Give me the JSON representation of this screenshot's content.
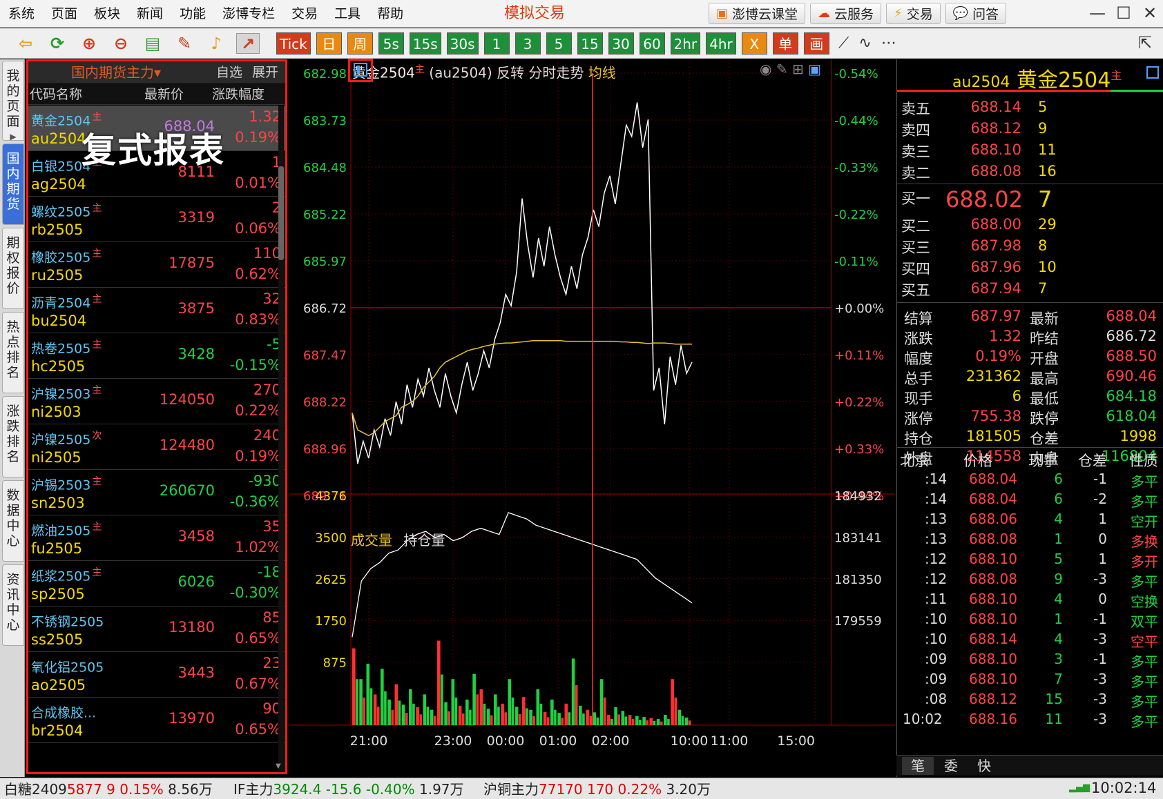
{
  "menu": {
    "items": [
      "系统",
      "页面",
      "板块",
      "新闻",
      "功能",
      "澎博专栏",
      "交易",
      "工具",
      "帮助"
    ],
    "app_title": "模拟交易",
    "buttons": [
      "澎博云课堂",
      "云服务",
      "交易",
      "问答"
    ]
  },
  "periods": [
    "Tick",
    "日",
    "周",
    "5s",
    "15s",
    "30s",
    "1",
    "3",
    "5",
    "15",
    "30",
    "60",
    "2hr",
    "4hr",
    "X",
    "单",
    "画"
  ],
  "sidebar": {
    "tabs": [
      "我的页面",
      "国内期货",
      "期权报价",
      "热点排名",
      "涨跌排名",
      "数据中心",
      "资讯中心"
    ]
  },
  "quote": {
    "title": "国内期货主力",
    "title_arrow": "▾",
    "options": "自选 展开",
    "columns": [
      "代码名称",
      "最新价",
      "涨跌幅度"
    ],
    "watermark": "复式报表",
    "rows": [
      {
        "name": "黄金2504",
        "tag": "主",
        "code": "au2504",
        "price": "688.04",
        "change": "1.32",
        "pct": "0.19%",
        "dir": "up"
      },
      {
        "name": "白银2504",
        "tag": "主",
        "code": "ag2504",
        "price": "8111",
        "change": "1",
        "pct": "0.01%",
        "dir": "up"
      },
      {
        "name": "螺纹2505",
        "tag": "主",
        "code": "rb2505",
        "price": "3319",
        "change": "2",
        "pct": "0.06%",
        "dir": "up"
      },
      {
        "name": "橡胶2505",
        "tag": "主",
        "code": "ru2505",
        "price": "17875",
        "change": "110",
        "pct": "0.62%",
        "dir": "up"
      },
      {
        "name": "沥青2504",
        "tag": "主",
        "code": "bu2504",
        "price": "3875",
        "change": "32",
        "pct": "0.83%",
        "dir": "up"
      },
      {
        "name": "热卷2505",
        "tag": "主",
        "code": "hc2505",
        "price": "3428",
        "change": "-5",
        "pct": "-0.15%",
        "dir": "down"
      },
      {
        "name": "沪镍2503",
        "tag": "主",
        "code": "ni2503",
        "price": "124050",
        "change": "270",
        "pct": "0.22%",
        "dir": "up"
      },
      {
        "name": "沪镍2505",
        "tag": "次",
        "code": "ni2505",
        "price": "124480",
        "change": "240",
        "pct": "0.19%",
        "dir": "up"
      },
      {
        "name": "沪锡2503",
        "tag": "主",
        "code": "sn2503",
        "price": "260670",
        "change": "-930",
        "pct": "-0.36%",
        "dir": "down"
      },
      {
        "name": "燃油2505",
        "tag": "主",
        "code": "fu2505",
        "price": "3458",
        "change": "35",
        "pct": "1.02%",
        "dir": "up"
      },
      {
        "name": "纸浆2505",
        "tag": "主",
        "code": "sp2505",
        "price": "6026",
        "change": "-18",
        "pct": "-0.30%",
        "dir": "down"
      },
      {
        "name": "不锈钢2505",
        "tag": "",
        "code": "ss2505",
        "price": "13180",
        "change": "85",
        "pct": "0.65%",
        "dir": "up"
      },
      {
        "name": "氧化铝2505",
        "tag": "",
        "code": "ao2505",
        "price": "3443",
        "change": "23",
        "pct": "0.67%",
        "dir": "up"
      },
      {
        "name": "合成橡胶...",
        "tag": "",
        "code": "br2504",
        "price": "13970",
        "change": "90",
        "pct": "0.65%",
        "dir": "up"
      }
    ]
  },
  "chart_header": {
    "name": "黄金2504",
    "tag": "主",
    "rest": "(au2504) 反转  分时走势",
    "avg": "均线",
    "vol_label": "成交量",
    "oi_label": "持仓量"
  },
  "chart_data": {
    "type": "line",
    "price_axis": [
      "682.98",
      "683.73",
      "684.48",
      "685.22",
      "685.97",
      "686.72",
      "687.47",
      "688.22",
      "688.96",
      "689.71"
    ],
    "pct_axis": [
      "-0.54%",
      "-0.44%",
      "-0.33%",
      "-0.22%",
      "-0.11%",
      "+0.00%",
      "+0.11%",
      "+0.22%",
      "+0.33%",
      "+0.44%"
    ],
    "vol_axis": [
      "4376",
      "3500",
      "2625",
      "1750",
      "875"
    ],
    "oi_axis": [
      "184932",
      "183141",
      "181350",
      "179559"
    ],
    "time_axis": [
      "21:00",
      "23:00",
      "00:00",
      "01:00",
      "02:00",
      "10:00",
      "11:00",
      "15:00"
    ],
    "ylim": [
      682.98,
      690.46
    ],
    "reversed": true,
    "prev_settle": 686.72,
    "price": [
      689.0,
      689.9,
      689.5,
      689.8,
      689.3,
      689.6,
      689.1,
      689.4,
      688.8,
      689.2,
      688.5,
      688.9,
      688.4,
      688.7,
      688.2,
      688.6,
      688.9,
      688.3,
      688.7,
      689.0,
      688.5,
      688.1,
      688.6,
      688.3,
      687.9,
      688.2,
      687.7,
      687.4,
      686.9,
      687.1,
      686.5,
      685.2,
      686.0,
      686.6,
      685.9,
      686.4,
      685.7,
      686.2,
      686.6,
      686.9,
      686.4,
      686.8,
      686.2,
      685.9,
      685.4,
      685.7,
      685.1,
      684.8,
      685.3,
      684.6,
      683.9,
      684.1,
      683.5,
      684.3,
      683.8,
      688.6,
      688.2,
      689.2,
      688.0,
      688.5,
      687.8,
      688.3,
      688.1
    ],
    "avg": [
      689.0,
      689.3,
      689.35,
      689.4,
      689.35,
      689.25,
      689.15,
      689.1,
      689.05,
      688.9,
      688.85,
      688.8,
      688.7,
      688.55,
      688.45,
      688.35,
      688.2,
      688.1,
      688.05,
      688.0,
      687.95,
      687.9,
      687.87,
      687.85,
      687.82,
      687.8,
      687.78,
      687.77,
      687.76,
      687.76,
      687.75,
      687.74,
      687.73,
      687.72,
      687.72,
      687.72,
      687.72,
      687.72,
      687.72,
      687.73,
      687.73,
      687.73,
      687.73,
      687.73,
      687.73,
      687.73,
      687.73,
      687.73,
      687.73,
      687.74,
      687.74,
      687.75,
      687.75,
      687.76,
      687.77,
      687.76,
      687.76,
      687.76,
      687.77,
      687.78,
      687.78,
      687.78,
      687.78
    ],
    "oi": [
      180600,
      182400,
      182800,
      183000,
      183300,
      183400,
      183700,
      183900,
      184000,
      183800,
      183900,
      183700,
      183800,
      184000,
      184100,
      184000,
      183900,
      184600,
      184500,
      184400,
      184200,
      184100,
      184000,
      183900,
      183800,
      183700,
      183600,
      183500,
      183400,
      183300,
      183200,
      183100,
      182800,
      182500,
      182300,
      182100,
      181900,
      181700
    ],
    "vol": [
      1500,
      900,
      1200,
      600,
      1100,
      500,
      800,
      400,
      700,
      350,
      600,
      300,
      1650,
      450,
      900,
      380,
      500,
      1000,
      700,
      320,
      600,
      420,
      900,
      360,
      550,
      300,
      700,
      260,
      500,
      240,
      420,
      1300,
      380,
      300,
      250,
      900,
      200,
      350,
      280,
      200,
      180,
      160,
      140,
      120,
      200,
      900,
      300,
      150
    ]
  },
  "level2": {
    "code": "au2504",
    "name": "黄金2504",
    "tag": "主",
    "asks": [
      {
        "label": "卖五",
        "price": "688.14",
        "vol": "5"
      },
      {
        "label": "卖四",
        "price": "688.12",
        "vol": "9"
      },
      {
        "label": "卖三",
        "price": "688.10",
        "vol": "11"
      },
      {
        "label": "卖二",
        "price": "688.08",
        "vol": "16"
      }
    ],
    "bids": [
      {
        "label": "买一",
        "price": "688.02",
        "vol": "7"
      },
      {
        "label": "买二",
        "price": "688.00",
        "vol": "29"
      },
      {
        "label": "买三",
        "price": "687.98",
        "vol": "8"
      },
      {
        "label": "买四",
        "price": "687.96",
        "vol": "10"
      },
      {
        "label": "买五",
        "price": "687.94",
        "vol": "7"
      }
    ],
    "stats": [
      {
        "l1": "结算",
        "v1": "687.97",
        "c1": "#ff4444",
        "l2": "最新",
        "v2": "688.04",
        "c2": "#ff4444"
      },
      {
        "l1": "涨跌",
        "v1": "1.32",
        "c1": "#ff4444",
        "l2": "昨结",
        "v2": "686.72",
        "c2": "#dddddd"
      },
      {
        "l1": "幅度",
        "v1": "0.19%",
        "c1": "#ff4444",
        "l2": "开盘",
        "v2": "688.50",
        "c2": "#ff4444"
      },
      {
        "l1": "总手",
        "v1": "231362",
        "c1": "#f5d800",
        "l2": "最高",
        "v2": "690.46",
        "c2": "#ff4444"
      },
      {
        "l1": "现手",
        "v1": "6",
        "c1": "#f5d800",
        "l2": "最低",
        "v2": "684.18",
        "c2": "#20d040"
      },
      {
        "l1": "涨停",
        "v1": "755.38",
        "c1": "#ff4444",
        "l2": "跌停",
        "v2": "618.04",
        "c2": "#20d040"
      },
      {
        "l1": "持仓",
        "v1": "181505",
        "c1": "#f5d800",
        "l2": "仓差",
        "v2": "1998",
        "c2": "#f5d800"
      },
      {
        "l1": "外盘",
        "v1": "114558",
        "c1": "#ff4444",
        "l2": "内盘",
        "v2": "116804",
        "c2": "#20d040"
      }
    ],
    "tick_header": [
      "北京",
      "价格",
      "现手",
      "仓差",
      "性质"
    ],
    "ticks": [
      {
        "t": ":14",
        "p": "688.04",
        "v": "6",
        "d": "-1",
        "n": "多平",
        "nc": "#20d040"
      },
      {
        "t": ":14",
        "p": "688.04",
        "v": "6",
        "d": "-2",
        "n": "多平",
        "nc": "#20d040"
      },
      {
        "t": ":13",
        "p": "688.06",
        "v": "4",
        "d": "1",
        "n": "空开",
        "nc": "#20d040"
      },
      {
        "t": ":13",
        "p": "688.08",
        "v": "1",
        "d": "0",
        "n": "多换",
        "nc": "#ff4444"
      },
      {
        "t": ":12",
        "p": "688.10",
        "v": "5",
        "d": "1",
        "n": "多开",
        "nc": "#ff4444"
      },
      {
        "t": ":12",
        "p": "688.08",
        "v": "9",
        "d": "-3",
        "n": "多平",
        "nc": "#20d040"
      },
      {
        "t": ":11",
        "p": "688.10",
        "v": "4",
        "d": "0",
        "n": "空换",
        "nc": "#20d040"
      },
      {
        "t": ":10",
        "p": "688.10",
        "v": "1",
        "d": "-1",
        "n": "双平",
        "nc": "#20d040"
      },
      {
        "t": ":10",
        "p": "688.14",
        "v": "4",
        "d": "-3",
        "n": "空平",
        "nc": "#ff4444"
      },
      {
        "t": ":09",
        "p": "688.10",
        "v": "3",
        "d": "-1",
        "n": "多平",
        "nc": "#20d040"
      },
      {
        "t": ":09",
        "p": "688.10",
        "v": "7",
        "d": "-3",
        "n": "多平",
        "nc": "#20d040"
      },
      {
        "t": ":08",
        "p": "688.12",
        "v": "15",
        "d": "-3",
        "n": "多平",
        "nc": "#20d040"
      },
      {
        "t": "10:02",
        "p": "688.16",
        "v": "11",
        "d": "-3",
        "n": "多平",
        "nc": "#20d040"
      }
    ],
    "bottom_tabs": [
      "笔",
      "委",
      "快"
    ]
  },
  "statusbar": [
    {
      "name": "白糖2409",
      "price": "5877",
      "chg": "9",
      "pct": "0.15%",
      "vol": "8.56万",
      "c": "#e00000"
    },
    {
      "name": "IF主力",
      "price": "3924.4",
      "chg": "-15.6",
      "pct": "-0.40%",
      "vol": "1.97万",
      "c": "#008a00"
    },
    {
      "name": "沪铜主力",
      "price": "77170",
      "chg": "170",
      "pct": "0.22%",
      "vol": "3.20万",
      "c": "#e00000"
    }
  ],
  "clock": "10:02:14"
}
